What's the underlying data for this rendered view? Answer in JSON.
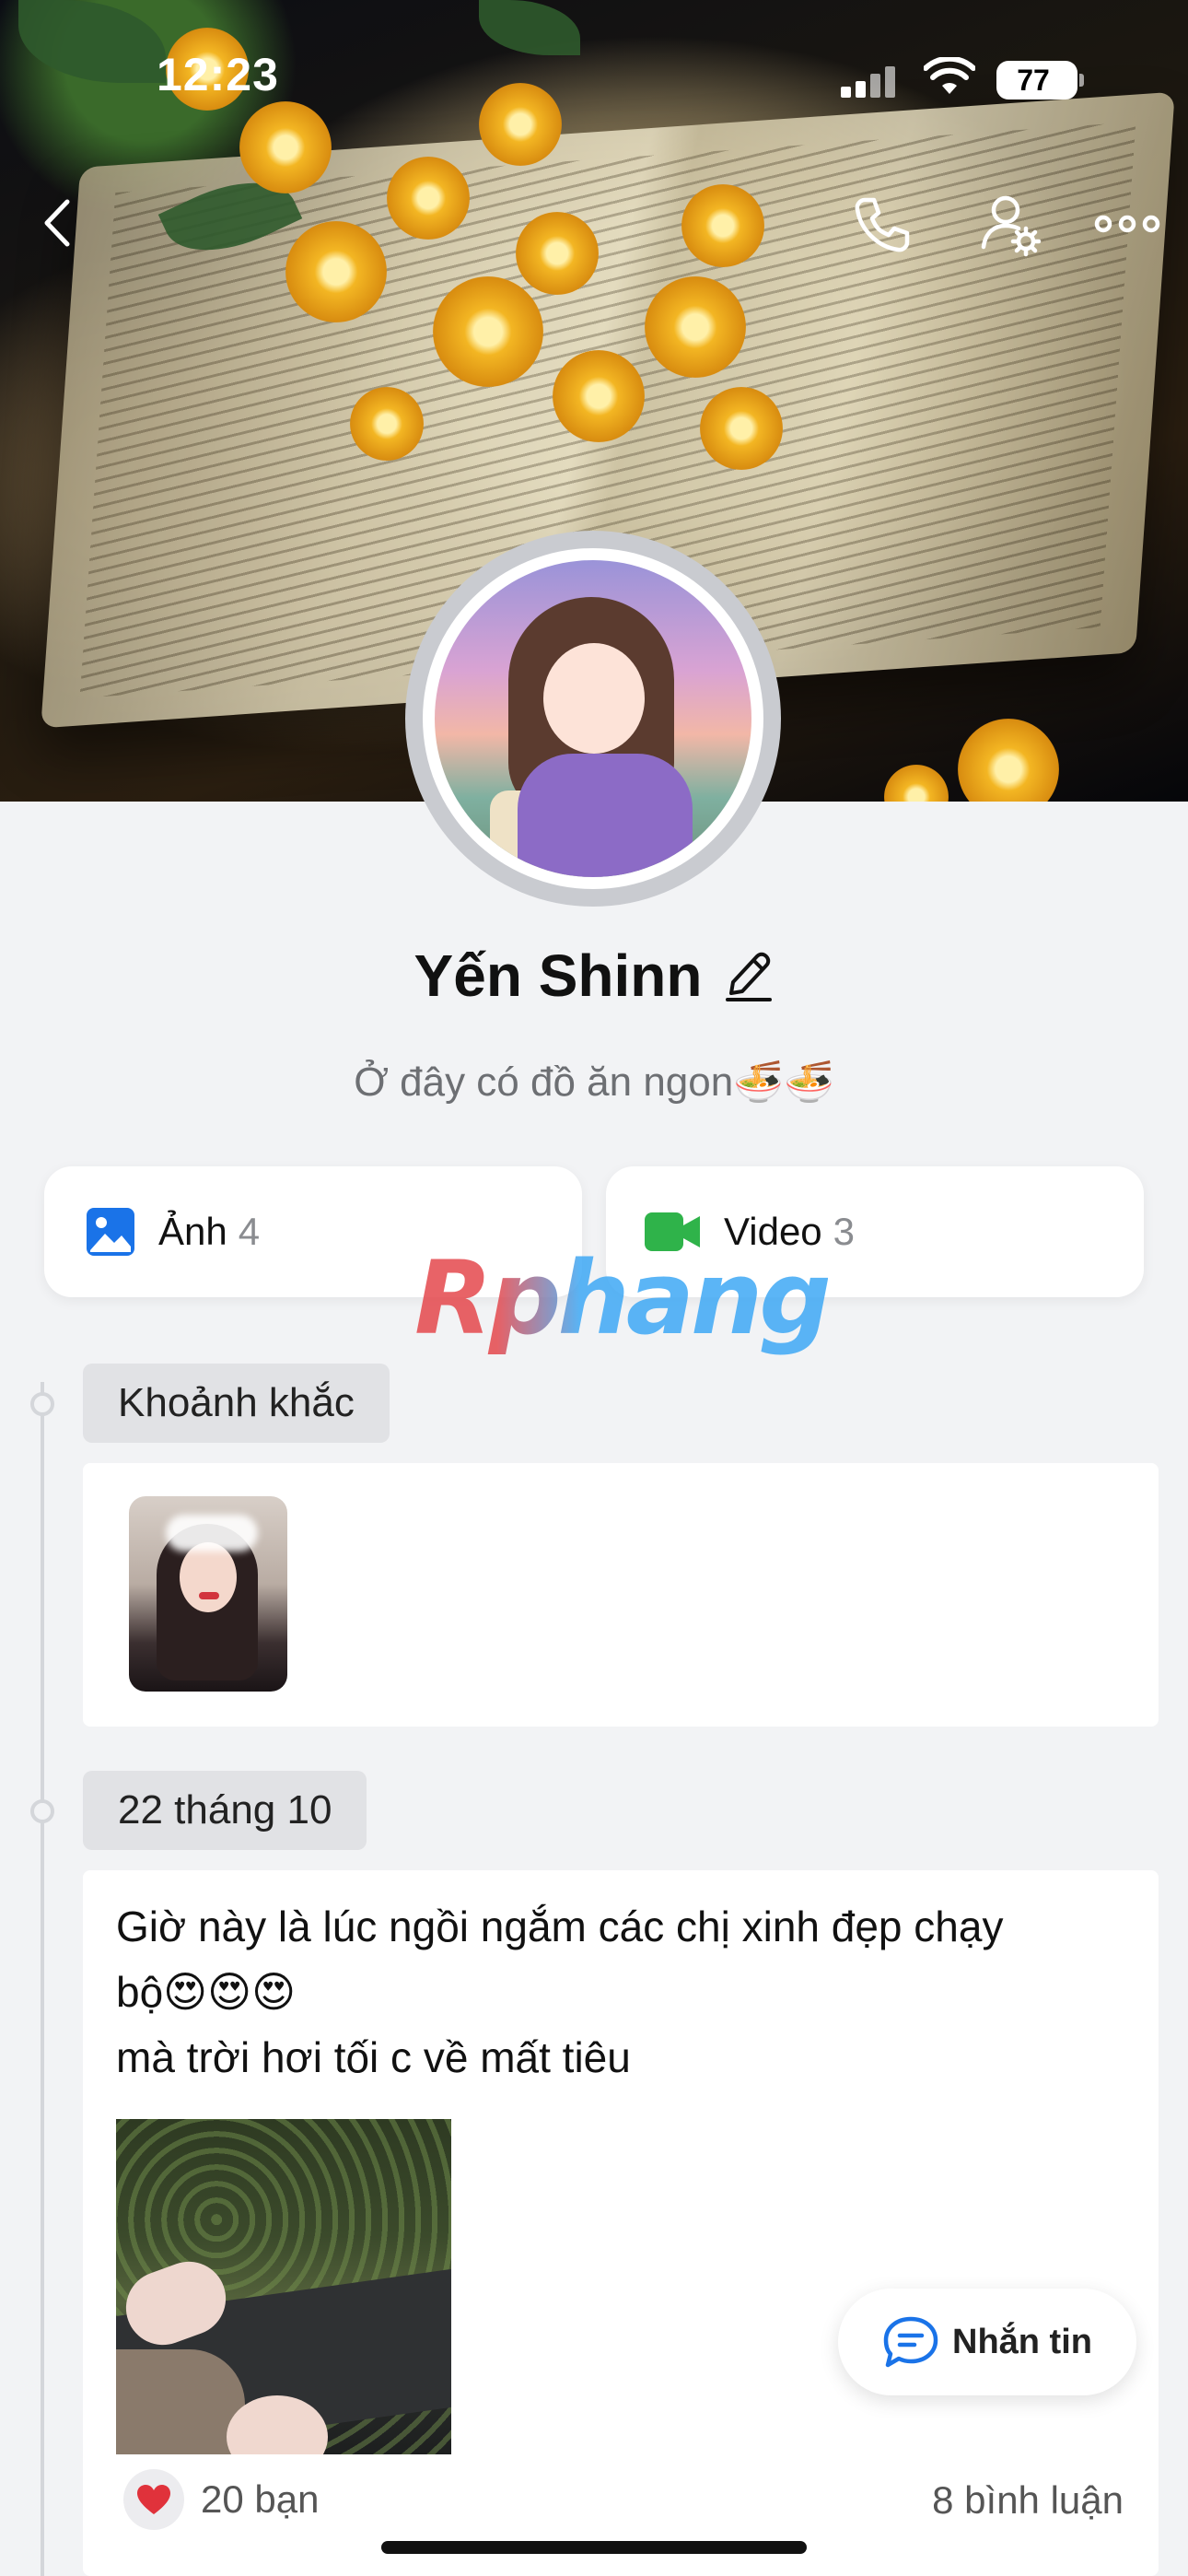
{
  "status_bar": {
    "time": "12:23",
    "battery": "77"
  },
  "profile": {
    "name": "Yến Shinn",
    "bio": "Ở đây có đồ ăn ngon🍜🍜"
  },
  "media": {
    "photos": {
      "label": "Ảnh",
      "count": "4"
    },
    "videos": {
      "label": "Video",
      "count": "3"
    }
  },
  "watermark": "Rphang",
  "timeline": {
    "moments_label": "Khoảnh khắc",
    "post": {
      "date": "22 tháng 10",
      "text": "Giờ này là lúc ngồi ngắm các chị xinh đẹp chạy\nbộ😍😍😍\n mà trời hơi tối c về mất tiêu",
      "reactions": "20 bạn",
      "comments": "8 bình luận"
    }
  },
  "fab": {
    "label": "Nhắn tin"
  },
  "colors": {
    "accent_blue": "#1a73e8",
    "video_green": "#2fb34a",
    "heart_red": "#e0323b"
  },
  "icons": [
    "back-icon",
    "phone-icon",
    "user-settings-icon",
    "more-icon",
    "pencil-icon",
    "image-icon",
    "video-icon",
    "heart-icon",
    "chat-bubble-icon"
  ]
}
